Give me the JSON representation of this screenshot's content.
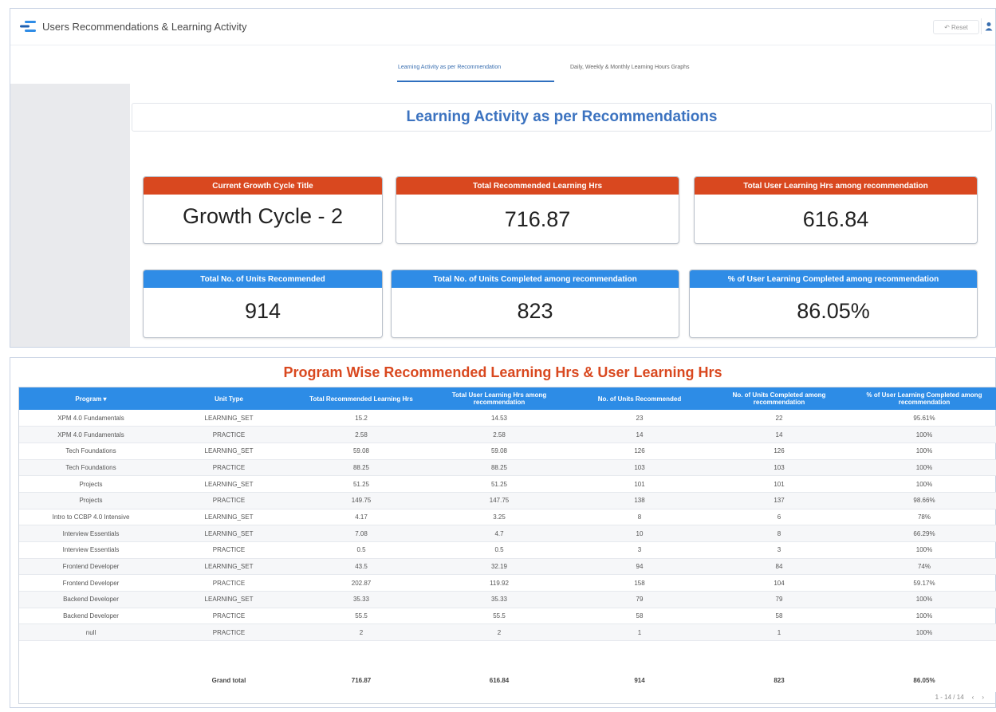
{
  "header": {
    "title": "Users Recommendations & Learning Activity",
    "reset_label": "↶ Reset"
  },
  "tabs": [
    {
      "label": "Learning Activity as per Recommendation"
    },
    {
      "label": "Daily, Weekly & Monthly Learning Hours Graphs"
    }
  ],
  "section_title": "Learning Activity as per Recommendations",
  "kpis": [
    {
      "label": "Current Growth Cycle Title",
      "value": "Growth Cycle - 2"
    },
    {
      "label": "Total Recommended Learning Hrs",
      "value": "716.87"
    },
    {
      "label": "Total User Learning Hrs among recommendation",
      "value": "616.84"
    },
    {
      "label": "Total No. of Units Recommended",
      "value": "914"
    },
    {
      "label": "Total No. of Units Completed among recommendation",
      "value": "823"
    },
    {
      "label": "% of User Learning Completed among recommendation",
      "value": "86.05%"
    }
  ],
  "colors": {
    "accent_red": "#d9481f",
    "accent_blue": "#2f8ce6",
    "title_blue": "#3c73c0"
  },
  "table": {
    "title": "Program Wise Recommended Learning Hrs & User Learning Hrs",
    "columns": [
      "Program ▾",
      "Unit Type",
      "Total Recommended Learning Hrs",
      "Total User Learning Hrs among recommendation",
      "No. of Units Recommended",
      "No. of Units Completed among recommendation",
      "% of User Learning Completed among recommendation"
    ],
    "rows": [
      [
        "XPM 4.0 Fundamentals",
        "LEARNING_SET",
        "15.2",
        "14.53",
        "23",
        "22",
        "95.61%"
      ],
      [
        "XPM 4.0 Fundamentals",
        "PRACTICE",
        "2.58",
        "2.58",
        "14",
        "14",
        "100%"
      ],
      [
        "Tech Foundations",
        "LEARNING_SET",
        "59.08",
        "59.08",
        "126",
        "126",
        "100%"
      ],
      [
        "Tech Foundations",
        "PRACTICE",
        "88.25",
        "88.25",
        "103",
        "103",
        "100%"
      ],
      [
        "Projects",
        "LEARNING_SET",
        "51.25",
        "51.25",
        "101",
        "101",
        "100%"
      ],
      [
        "Projects",
        "PRACTICE",
        "149.75",
        "147.75",
        "138",
        "137",
        "98.66%"
      ],
      [
        "Intro to CCBP 4.0 Intensive",
        "LEARNING_SET",
        "4.17",
        "3.25",
        "8",
        "6",
        "78%"
      ],
      [
        "Interview Essentials",
        "LEARNING_SET",
        "7.08",
        "4.7",
        "10",
        "8",
        "66.29%"
      ],
      [
        "Interview Essentials",
        "PRACTICE",
        "0.5",
        "0.5",
        "3",
        "3",
        "100%"
      ],
      [
        "Frontend Developer",
        "LEARNING_SET",
        "43.5",
        "32.19",
        "94",
        "84",
        "74%"
      ],
      [
        "Frontend Developer",
        "PRACTICE",
        "202.87",
        "119.92",
        "158",
        "104",
        "59.17%"
      ],
      [
        "Backend Developer",
        "LEARNING_SET",
        "35.33",
        "35.33",
        "79",
        "79",
        "100%"
      ],
      [
        "Backend Developer",
        "PRACTICE",
        "55.5",
        "55.5",
        "58",
        "58",
        "100%"
      ],
      [
        "null",
        "PRACTICE",
        "2",
        "2",
        "1",
        "1",
        "100%"
      ]
    ],
    "total": [
      "",
      "Grand total",
      "716.87",
      "616.84",
      "914",
      "823",
      "86.05%"
    ],
    "pager": "1 - 14 / 14"
  }
}
